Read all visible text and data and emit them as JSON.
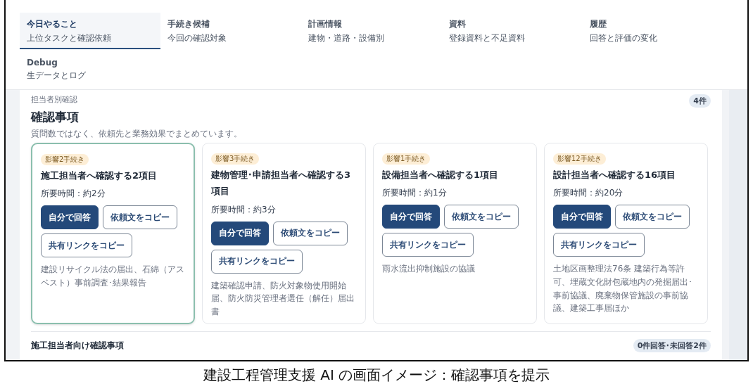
{
  "tabs": [
    {
      "title": "今日やること",
      "subtitle": "上位タスクと確認依頼",
      "selected": true
    },
    {
      "title": "手続き候補",
      "subtitle": "今回の確認対象",
      "selected": false
    },
    {
      "title": "計画情報",
      "subtitle": "建物・道路・設備別",
      "selected": false
    },
    {
      "title": "資料",
      "subtitle": "登録資料と不足資料",
      "selected": false
    },
    {
      "title": "履歴",
      "subtitle": "回答と評価の変化",
      "selected": false
    },
    {
      "title": "Debug",
      "subtitle": "生データとログ",
      "selected": false
    }
  ],
  "section": {
    "eyebrow": "担当者別確認",
    "title": "確認事項",
    "description": "質問数ではなく、依頼先と業務効果でまとめています。",
    "count_badge": "4件",
    "cards": [
      {
        "impact": "影響2手続き",
        "title": "施工担当者へ確認する2項目",
        "duration": "所要時間：約2分",
        "selected": true,
        "buttons": [
          {
            "label": "自分で回答",
            "kind": "primary"
          },
          {
            "label": "依頼文をコピー",
            "kind": "outline"
          },
          {
            "label": "共有リンクをコピー",
            "kind": "outline"
          }
        ],
        "procedures": "建設リサイクル法の届出、石綿（アスベスト）事前調査･結果報告"
      },
      {
        "impact": "影響3手続き",
        "title": "建物管理･申請担当者へ確認する3項目",
        "duration": "所要時間：約3分",
        "selected": false,
        "buttons": [
          {
            "label": "自分で回答",
            "kind": "primary"
          },
          {
            "label": "依頼文をコピー",
            "kind": "outline"
          },
          {
            "label": "共有リンクをコピー",
            "kind": "outline"
          }
        ],
        "procedures": "建築確認申請、防火対象物使用開始届、防火防災管理者選任（解任）届出書"
      },
      {
        "impact": "影響1手続き",
        "title": "設備担当者へ確認する1項目",
        "duration": "所要時間：約1分",
        "selected": false,
        "buttons": [
          {
            "label": "自分で回答",
            "kind": "primary"
          },
          {
            "label": "依頼文をコピー",
            "kind": "outline"
          },
          {
            "label": "共有リンクをコピー",
            "kind": "outline"
          }
        ],
        "procedures": "雨水流出抑制施設の協議"
      },
      {
        "impact": "影響12手続き",
        "title": "設計担当者へ確認する16項目",
        "duration": "所要時間：約20分",
        "selected": false,
        "buttons": [
          {
            "label": "自分で回答",
            "kind": "primary"
          },
          {
            "label": "依頼文をコピー",
            "kind": "outline"
          },
          {
            "label": "共有リンクをコピー",
            "kind": "outline"
          }
        ],
        "procedures": "土地区画整理法76条 建築行為等許可、埋蔵文化財包蔵地内の発掘届出･事前協議、廃棄物保管施設の事前協議、建築工事届ほか"
      }
    ]
  },
  "next_section": {
    "title": "施工担当者向け確認事項",
    "badge": "0件回答･未回答2件"
  },
  "caption": "建設工程管理支援 AI の画面イメージ：確認事項を提示"
}
